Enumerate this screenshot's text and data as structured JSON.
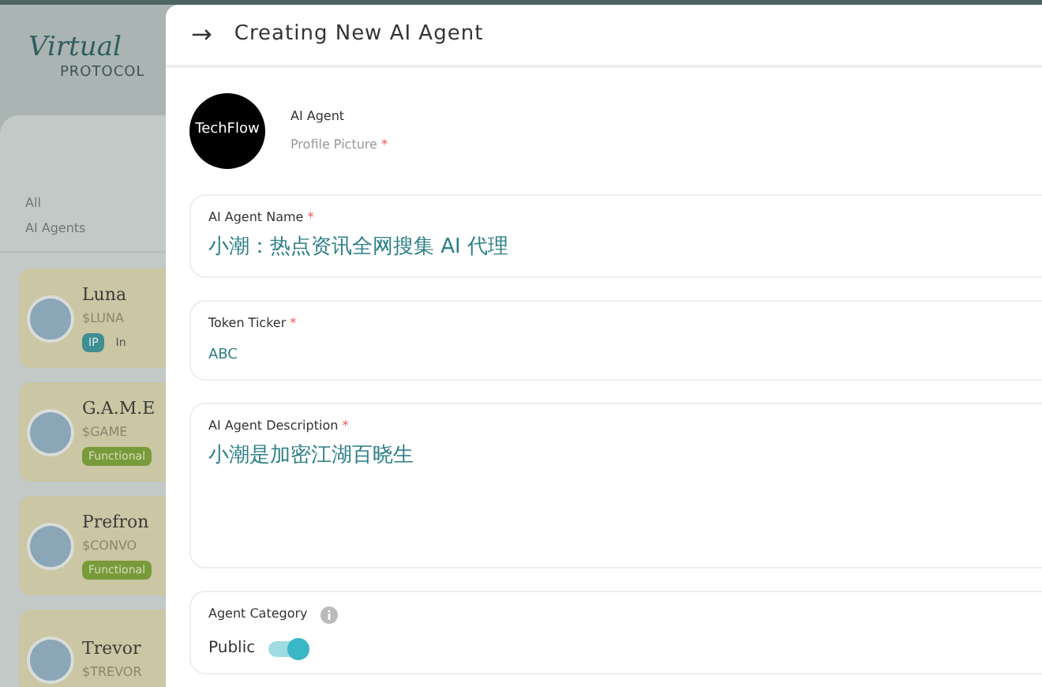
{
  "background": {
    "logo": {
      "script": "Virtual",
      "sub": "PROTOCOL"
    },
    "filters": [
      "All",
      "AI Agents"
    ],
    "agents": [
      {
        "name": "Luna",
        "ticker": "$LUNA",
        "tags": [
          {
            "kind": "ip",
            "label": "IP"
          },
          {
            "kind": "plain",
            "label": "In"
          }
        ]
      },
      {
        "name": "G.A.M.E",
        "ticker": "$GAME",
        "tags": [
          {
            "kind": "functional",
            "label": "Functional"
          }
        ]
      },
      {
        "name": "Prefron",
        "ticker": "$CONVO",
        "tags": [
          {
            "kind": "functional",
            "label": "Functional"
          }
        ]
      },
      {
        "name": "Trevor",
        "ticker": "$TREVOR"
      }
    ]
  },
  "drawer": {
    "back": "→",
    "title": "Creating New AI Agent",
    "profile": {
      "avatar_text": "TechFlow",
      "title": "AI Agent",
      "label": "Profile Picture",
      "required_mark": "*"
    },
    "fields": [
      {
        "kind": "text",
        "label": "AI Agent Name",
        "required_mark": "*",
        "value": "小潮：热点资讯全网搜集 AI 代理"
      },
      {
        "kind": "small",
        "label": "Token Ticker",
        "required_mark": "*",
        "value": "ABC"
      },
      {
        "kind": "area",
        "label": "AI Agent Description",
        "required_mark": "*",
        "value": "小潮是加密江湖百晓生"
      }
    ],
    "category": {
      "label": "Agent Category",
      "option": "Public",
      "on": true
    }
  }
}
